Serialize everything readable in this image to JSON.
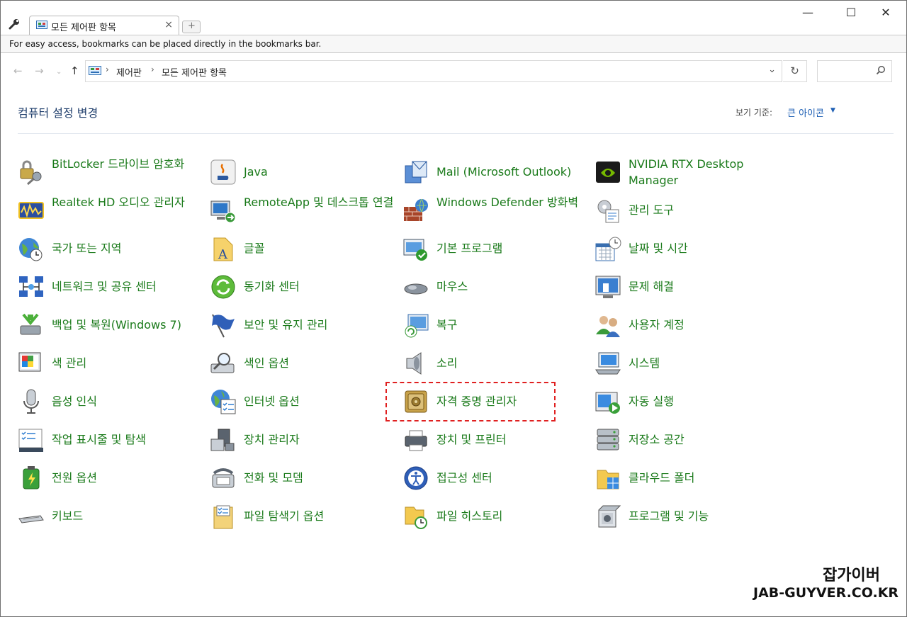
{
  "browser": {
    "tab_title": "모든 제어판 항목",
    "tab_close": "×",
    "newtab_glyph": "+",
    "bookmarks_hint": "For easy access, bookmarks can be placed directly in the bookmarks bar.",
    "win_min": "—",
    "win_max": "☐",
    "win_close": "✕"
  },
  "address": {
    "crumbs": [
      "제어판",
      "모든 제어판 항목"
    ],
    "separator": "›",
    "search_placeholder": ""
  },
  "header": {
    "title": "컴퓨터 설정 변경",
    "viewby_label": "보기 기준:",
    "viewby_value": "큰 아이콘"
  },
  "items": [
    {
      "label": "BitLocker 드라이브 암호화",
      "icon": "bitlocker-icon"
    },
    {
      "label": "Java",
      "icon": "java-icon"
    },
    {
      "label": "Mail (Microsoft Outlook)",
      "icon": "mail-icon"
    },
    {
      "label": "NVIDIA RTX Desktop Manager",
      "icon": "nvidia-icon"
    },
    {
      "label": "Realtek HD 오디오 관리자",
      "icon": "realtek-audio-icon"
    },
    {
      "label": "RemoteApp 및 데스크톱 연결",
      "icon": "remoteapp-icon"
    },
    {
      "label": "Windows Defender 방화벽",
      "icon": "firewall-icon"
    },
    {
      "label": "관리 도구",
      "icon": "admin-tools-icon"
    },
    {
      "label": "국가 또는 지역",
      "icon": "region-icon"
    },
    {
      "label": "글꼴",
      "icon": "fonts-icon"
    },
    {
      "label": "기본 프로그램",
      "icon": "default-programs-icon"
    },
    {
      "label": "날짜 및 시간",
      "icon": "date-time-icon"
    },
    {
      "label": "네트워크 및 공유 센터",
      "icon": "network-icon"
    },
    {
      "label": "동기화 센터",
      "icon": "sync-center-icon"
    },
    {
      "label": "마우스",
      "icon": "mouse-icon"
    },
    {
      "label": "문제 해결",
      "icon": "troubleshoot-icon"
    },
    {
      "label": "백업 및 복원(Windows 7)",
      "icon": "backup-icon"
    },
    {
      "label": "보안 및 유지 관리",
      "icon": "security-flag-icon"
    },
    {
      "label": "복구",
      "icon": "recovery-icon"
    },
    {
      "label": "사용자 계정",
      "icon": "user-accounts-icon"
    },
    {
      "label": "색 관리",
      "icon": "color-management-icon"
    },
    {
      "label": "색인 옵션",
      "icon": "indexing-icon"
    },
    {
      "label": "소리",
      "icon": "sound-icon"
    },
    {
      "label": "시스템",
      "icon": "system-icon"
    },
    {
      "label": "음성 인식",
      "icon": "microphone-icon"
    },
    {
      "label": "인터넷 옵션",
      "icon": "internet-options-icon"
    },
    {
      "label": "자격 증명 관리자",
      "icon": "credential-vault-icon"
    },
    {
      "label": "자동 실행",
      "icon": "autoplay-icon"
    },
    {
      "label": "작업 표시줄 및 탐색",
      "icon": "taskbar-icon"
    },
    {
      "label": "장치 관리자",
      "icon": "device-manager-icon"
    },
    {
      "label": "장치 및 프린터",
      "icon": "devices-printers-icon"
    },
    {
      "label": "저장소 공간",
      "icon": "storage-spaces-icon"
    },
    {
      "label": "전원 옵션",
      "icon": "power-options-icon"
    },
    {
      "label": "전화 및 모뎀",
      "icon": "phone-modem-icon"
    },
    {
      "label": "접근성 센터",
      "icon": "accessibility-icon"
    },
    {
      "label": "클라우드 폴더",
      "icon": "cloud-folder-icon"
    },
    {
      "label": "키보드",
      "icon": "keyboard-icon"
    },
    {
      "label": "파일 탐색기 옵션",
      "icon": "explorer-options-icon"
    },
    {
      "label": "파일 히스토리",
      "icon": "file-history-icon"
    },
    {
      "label": "프로그램 및 기능",
      "icon": "programs-features-icon"
    }
  ],
  "watermark": {
    "line1": "잡가이버",
    "line2": "JAB-GUYVER.CO.KR"
  }
}
